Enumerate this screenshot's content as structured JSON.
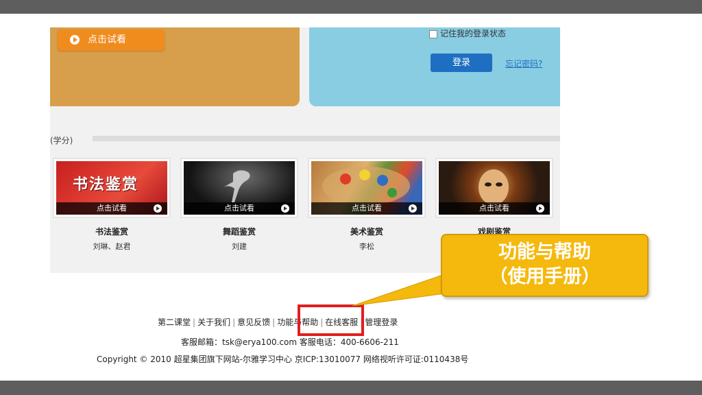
{
  "login": {
    "remember_label": "记住我的登录状态",
    "login_button": "登录",
    "forgot_link": "忘记密码?"
  },
  "banner": {
    "trial_button": "点击试看"
  },
  "section": {
    "title_fragment": "(学分)"
  },
  "courses": [
    {
      "name": "书法鉴赏",
      "teacher": "刘琳、赵君",
      "overlay": "点击试看",
      "thumb_text": "书法鉴赏"
    },
    {
      "name": "舞蹈鉴赏",
      "teacher": "刘建",
      "overlay": "点击试看"
    },
    {
      "name": "美术鉴赏",
      "teacher": "李松",
      "overlay": "点击试看"
    },
    {
      "name": "戏剧鉴赏",
      "teacher": "",
      "overlay": "点击试看"
    }
  ],
  "footer": {
    "links": [
      "第二课堂",
      "关于我们",
      "意见反馈",
      "功能与帮助",
      "在线客服",
      "管理登录"
    ],
    "contact": "客服邮箱：tsk@erya100.com  客服电话：400-6606-211",
    "copyright": "Copyright © 2010 超星集团旗下网站-尔雅学习中心 京ICP:13010077 网络视听许可证:0110438号"
  },
  "callout": {
    "line1": "功能与帮助",
    "line2": "（使用手册）"
  },
  "colors": {
    "callout_fill": "#f5b90d",
    "highlight_border": "#e31d1d",
    "login_button": "#1e6fc2",
    "trial_button": "#f08b1e"
  }
}
